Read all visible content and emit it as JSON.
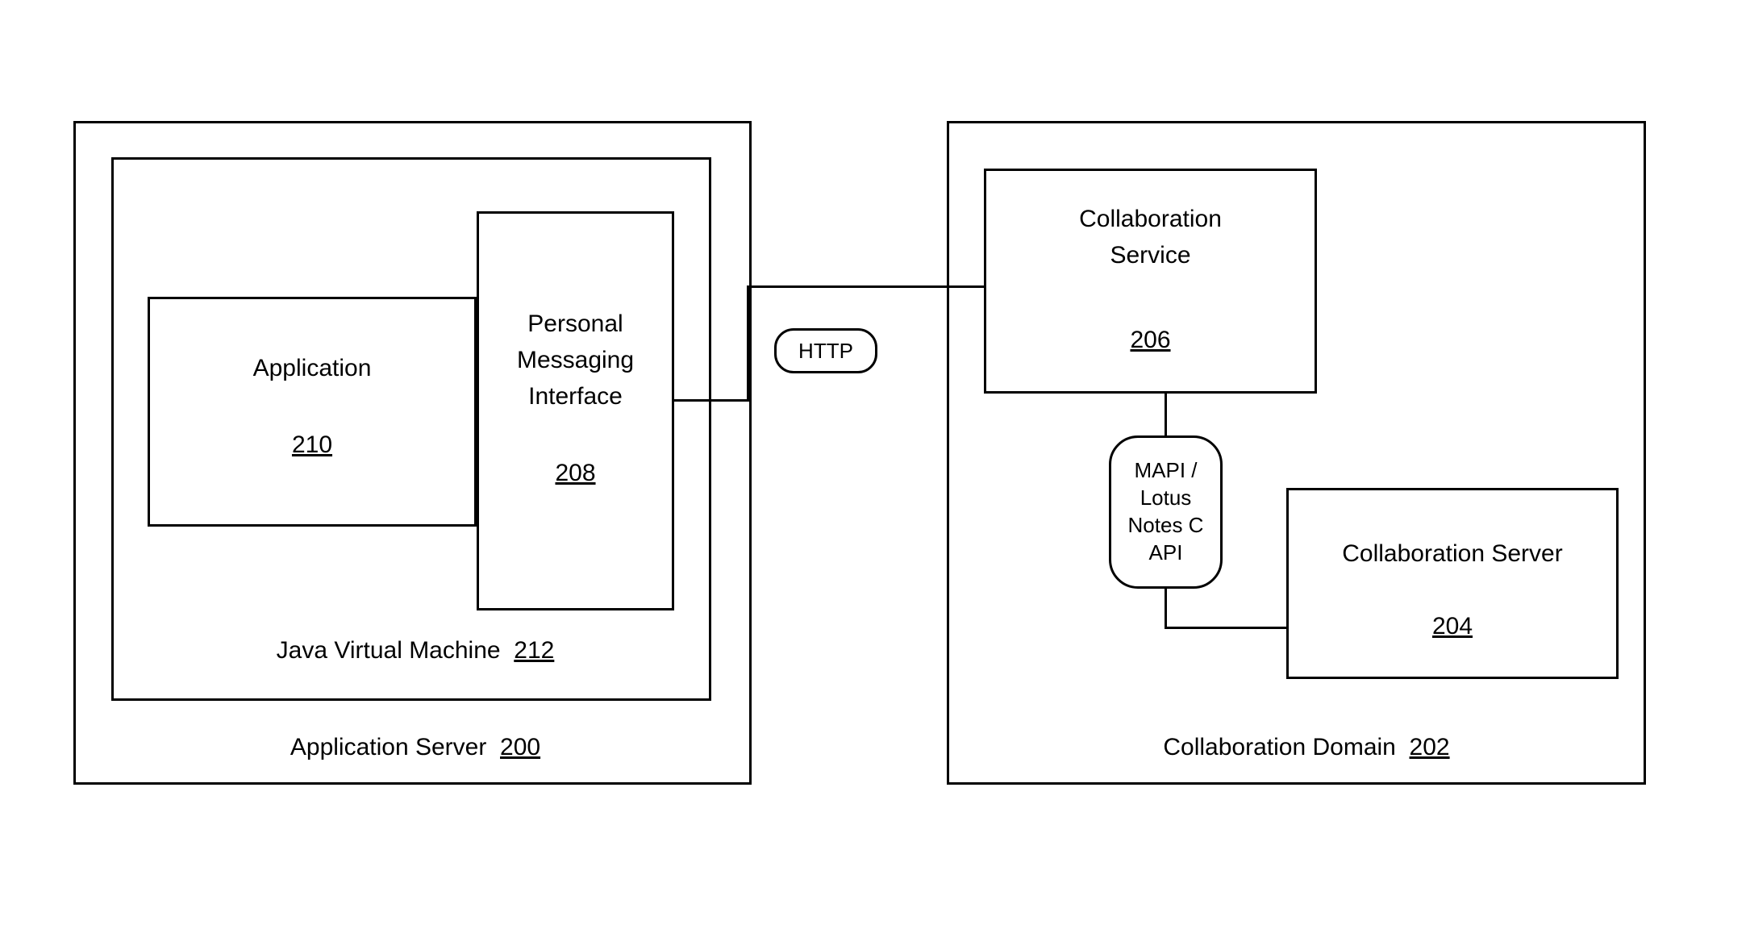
{
  "left": {
    "outer": {
      "label": "Application Server",
      "num": "200"
    },
    "jvm": {
      "label": "Java Virtual Machine",
      "num": "212"
    },
    "app": {
      "label": "Application",
      "num": "210"
    },
    "pmi": {
      "line1": "Personal",
      "line2": "Messaging",
      "line3": "Interface",
      "num": "208"
    }
  },
  "right": {
    "outer": {
      "label": "Collaboration Domain",
      "num": "202"
    },
    "service": {
      "label": "Collaboration",
      "label2": "Service",
      "num": "206"
    },
    "server": {
      "label": "Collaboration Server",
      "num": "204"
    }
  },
  "connectors": {
    "http": "HTTP",
    "api": {
      "l1": "MAPI /",
      "l2": "Lotus",
      "l3": "Notes C",
      "l4": "API"
    }
  }
}
